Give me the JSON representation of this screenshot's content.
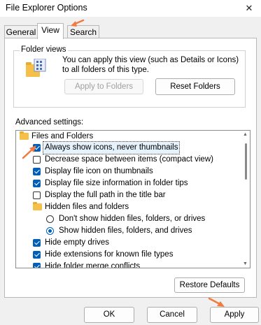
{
  "window": {
    "title": "File Explorer Options",
    "close_label": "✕"
  },
  "tabs": [
    {
      "label": "General",
      "active": false
    },
    {
      "label": "View",
      "active": true
    },
    {
      "label": "Search",
      "active": false
    }
  ],
  "folder_views": {
    "group_label": "Folder views",
    "description": "You can apply this view (such as Details or Icons) to all folders of this type.",
    "apply_button": "Apply to Folders",
    "reset_button": "Reset Folders"
  },
  "advanced": {
    "label": "Advanced settings:",
    "items": [
      {
        "type": "folder",
        "label": "Files and Folders"
      },
      {
        "type": "checkbox",
        "checked": true,
        "label": "Always show icons, never thumbnails",
        "selected": true
      },
      {
        "type": "checkbox",
        "checked": false,
        "label": "Decrease space between items (compact view)"
      },
      {
        "type": "checkbox",
        "checked": true,
        "label": "Display file icon on thumbnails"
      },
      {
        "type": "checkbox",
        "checked": true,
        "label": "Display file size information in folder tips"
      },
      {
        "type": "checkbox",
        "checked": false,
        "label": "Display the full path in the title bar"
      },
      {
        "type": "folder",
        "label": "Hidden files and folders"
      },
      {
        "type": "radio",
        "checked": false,
        "label": "Don't show hidden files, folders, or drives"
      },
      {
        "type": "radio",
        "checked": true,
        "label": "Show hidden files, folders, and drives"
      },
      {
        "type": "checkbox",
        "checked": true,
        "label": "Hide empty drives"
      },
      {
        "type": "checkbox",
        "checked": true,
        "label": "Hide extensions for known file types"
      },
      {
        "type": "checkbox",
        "checked": true,
        "label": "Hide folder merge conflicts"
      }
    ]
  },
  "restore_button": "Restore Defaults",
  "footer": {
    "ok": "OK",
    "cancel": "Cancel",
    "apply": "Apply"
  },
  "colors": {
    "accent": "#005fb8",
    "annotation": "#f07b3f"
  }
}
